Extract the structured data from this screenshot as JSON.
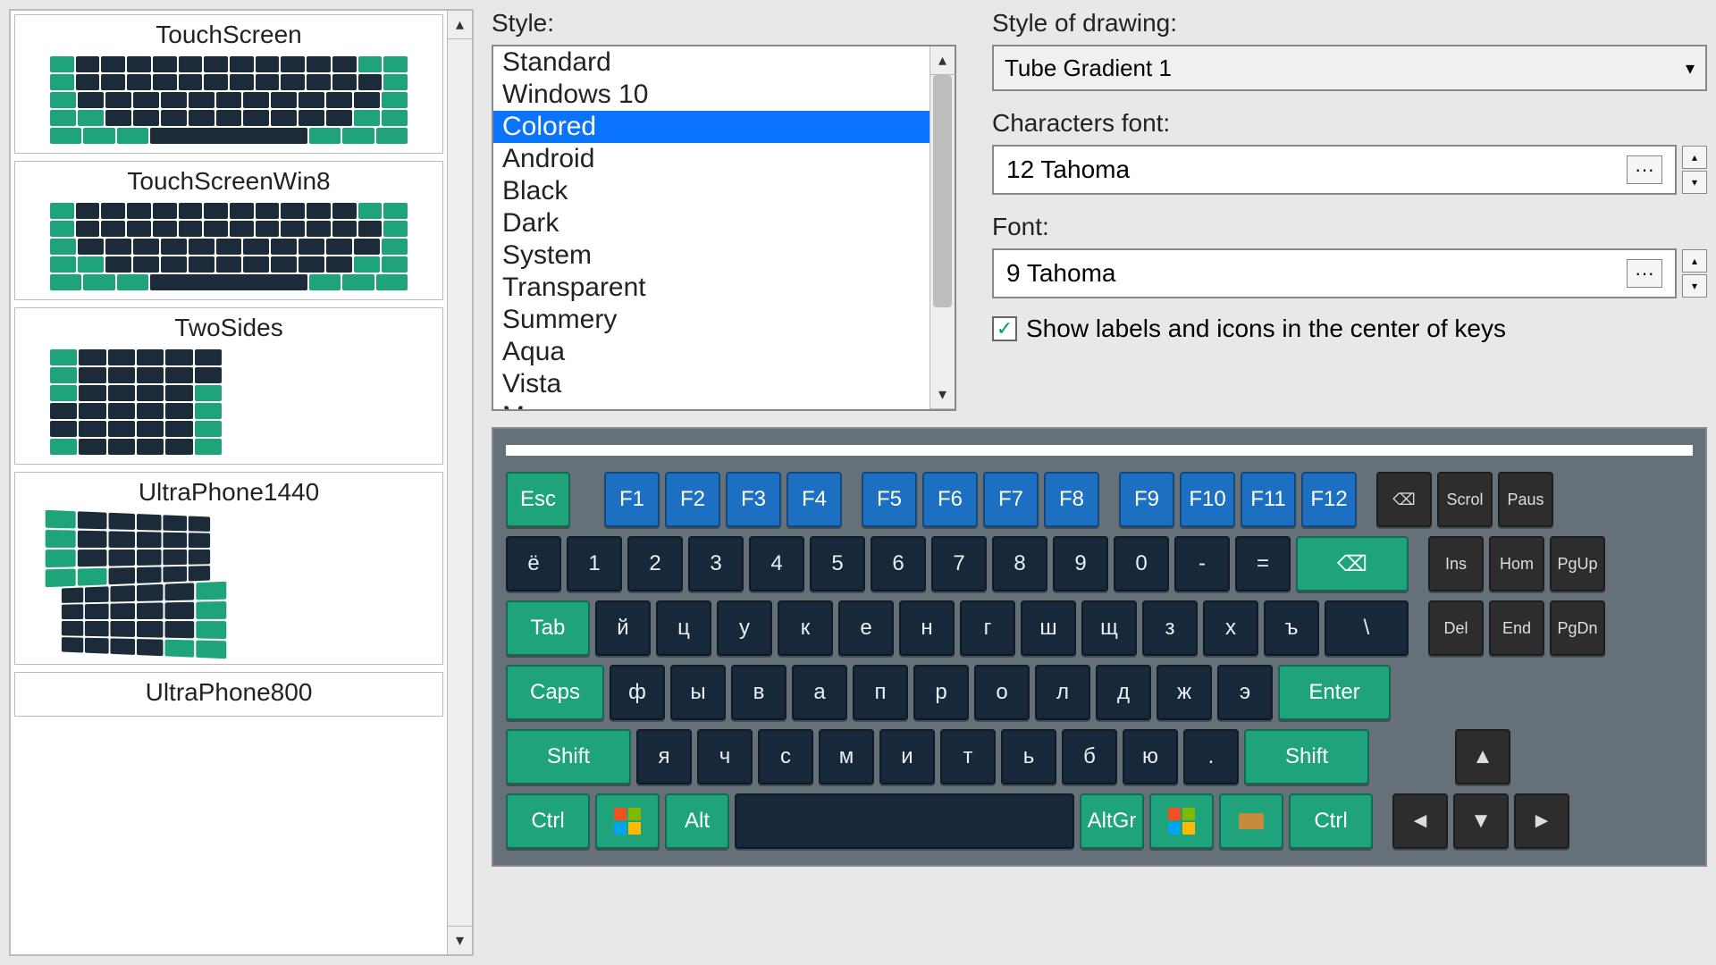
{
  "sidebar": {
    "items": [
      {
        "label": "TouchScreen"
      },
      {
        "label": "TouchScreenWin8"
      },
      {
        "label": "TwoSides"
      },
      {
        "label": "UltraPhone1440"
      },
      {
        "label": "UltraPhone800"
      }
    ]
  },
  "style": {
    "label": "Style:",
    "options": [
      "Standard",
      "Windows 10",
      "Colored",
      "Android",
      "Black",
      "Dark",
      "System",
      "Transparent",
      "Summery",
      "Aqua",
      "Vista",
      "Mac"
    ],
    "selected": "Colored"
  },
  "drawing": {
    "label": "Style of drawing:",
    "value": "Tube Gradient 1"
  },
  "char_font": {
    "label": "Characters font:",
    "value": "12 Tahoma"
  },
  "font": {
    "label": "Font:",
    "value": "9 Tahoma"
  },
  "checkbox": {
    "label": "Show labels and icons in the center of keys",
    "checked": true
  },
  "keyboard": {
    "row0": {
      "esc": "Esc",
      "f": [
        "F1",
        "F2",
        "F3",
        "F4",
        "F5",
        "F6",
        "F7",
        "F8",
        "F9",
        "F10",
        "F11",
        "F12"
      ],
      "extra": [
        "⌫",
        "Scrol",
        "Paus"
      ]
    },
    "row1": {
      "keys": [
        "ё",
        "1",
        "2",
        "3",
        "4",
        "5",
        "6",
        "7",
        "8",
        "9",
        "0",
        "-",
        "="
      ],
      "back": "⌫",
      "nav": [
        "Ins",
        "Hom",
        "PgUp"
      ]
    },
    "row2": {
      "tab": "Tab",
      "keys": [
        "й",
        "ц",
        "у",
        "к",
        "е",
        "н",
        "г",
        "ш",
        "щ",
        "з",
        "х",
        "ъ",
        "\\"
      ],
      "nav": [
        "Del",
        "End",
        "PgDn"
      ]
    },
    "row3": {
      "caps": "Caps",
      "keys": [
        "ф",
        "ы",
        "в",
        "а",
        "п",
        "р",
        "о",
        "л",
        "д",
        "ж",
        "э"
      ],
      "enter": "Enter"
    },
    "row4": {
      "shiftL": "Shift",
      "keys": [
        "я",
        "ч",
        "с",
        "м",
        "и",
        "т",
        "ь",
        "б",
        "ю",
        "."
      ],
      "shiftR": "Shift",
      "up": "▲"
    },
    "row5": {
      "ctrlL": "Ctrl",
      "alt": "Alt",
      "altgr": "AltGr",
      "ctrlR": "Ctrl",
      "arrows": [
        "◄",
        "▼",
        "►"
      ]
    }
  }
}
